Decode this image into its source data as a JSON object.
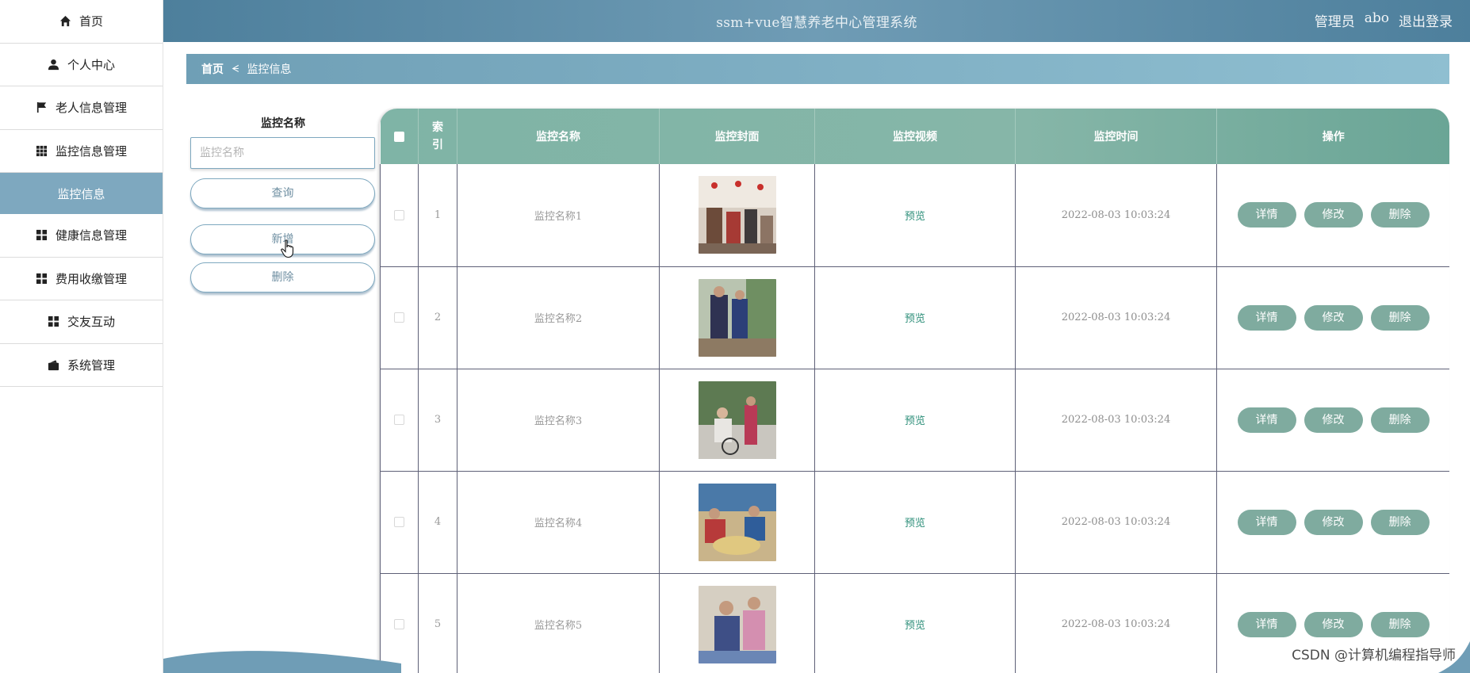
{
  "header": {
    "title": "ssm+vue智慧养老中心管理系统",
    "role": "管理员",
    "username": "abo",
    "logout": "退出登录"
  },
  "sidebar": {
    "items": [
      {
        "label": "首页",
        "icon": "home-icon"
      },
      {
        "label": "个人中心",
        "icon": "user-icon"
      },
      {
        "label": "老人信息管理",
        "icon": "flag-icon"
      },
      {
        "label": "监控信息管理",
        "icon": "grid-icon"
      },
      {
        "label": "监控信息",
        "icon": ""
      },
      {
        "label": "健康信息管理",
        "icon": "apps-icon"
      },
      {
        "label": "费用收缴管理",
        "icon": "apps-icon"
      },
      {
        "label": "交友互动",
        "icon": "apps-icon"
      },
      {
        "label": "系统管理",
        "icon": "wallet-icon"
      }
    ]
  },
  "breadcrumb": {
    "home": "首页",
    "separator": "ᗕ",
    "current": "监控信息"
  },
  "search": {
    "label": "监控名称",
    "placeholder": "监控名称",
    "query_btn": "查询",
    "add_btn": "新增",
    "delete_btn": "删除"
  },
  "table": {
    "headers": {
      "index": "索引",
      "name": "监控名称",
      "cover": "监控封面",
      "video": "监控视频",
      "time": "监控时间",
      "ops": "操作"
    },
    "rows": [
      {
        "index": "1",
        "name": "监控名称1",
        "video": "预览",
        "time": "2022-08-03 10:03:24"
      },
      {
        "index": "2",
        "name": "监控名称2",
        "video": "预览",
        "time": "2022-08-03 10:03:24"
      },
      {
        "index": "3",
        "name": "监控名称3",
        "video": "预览",
        "time": "2022-08-03 10:03:24"
      },
      {
        "index": "4",
        "name": "监控名称4",
        "video": "预览",
        "time": "2022-08-03 10:03:24"
      },
      {
        "index": "5",
        "name": "监控名称5",
        "video": "预览",
        "time": "2022-08-03 10:03:24"
      }
    ],
    "ops": {
      "detail": "详情",
      "edit": "修改",
      "delete": "删除"
    }
  },
  "watermark": "CSDN @计算机编程指导师",
  "colors": {
    "header": "#5b8ba8",
    "table_header": "#82b4a7",
    "op_button": "#7fab9f",
    "preview_link": "#2e8f7a",
    "active_menu": "#7ea8bf"
  }
}
